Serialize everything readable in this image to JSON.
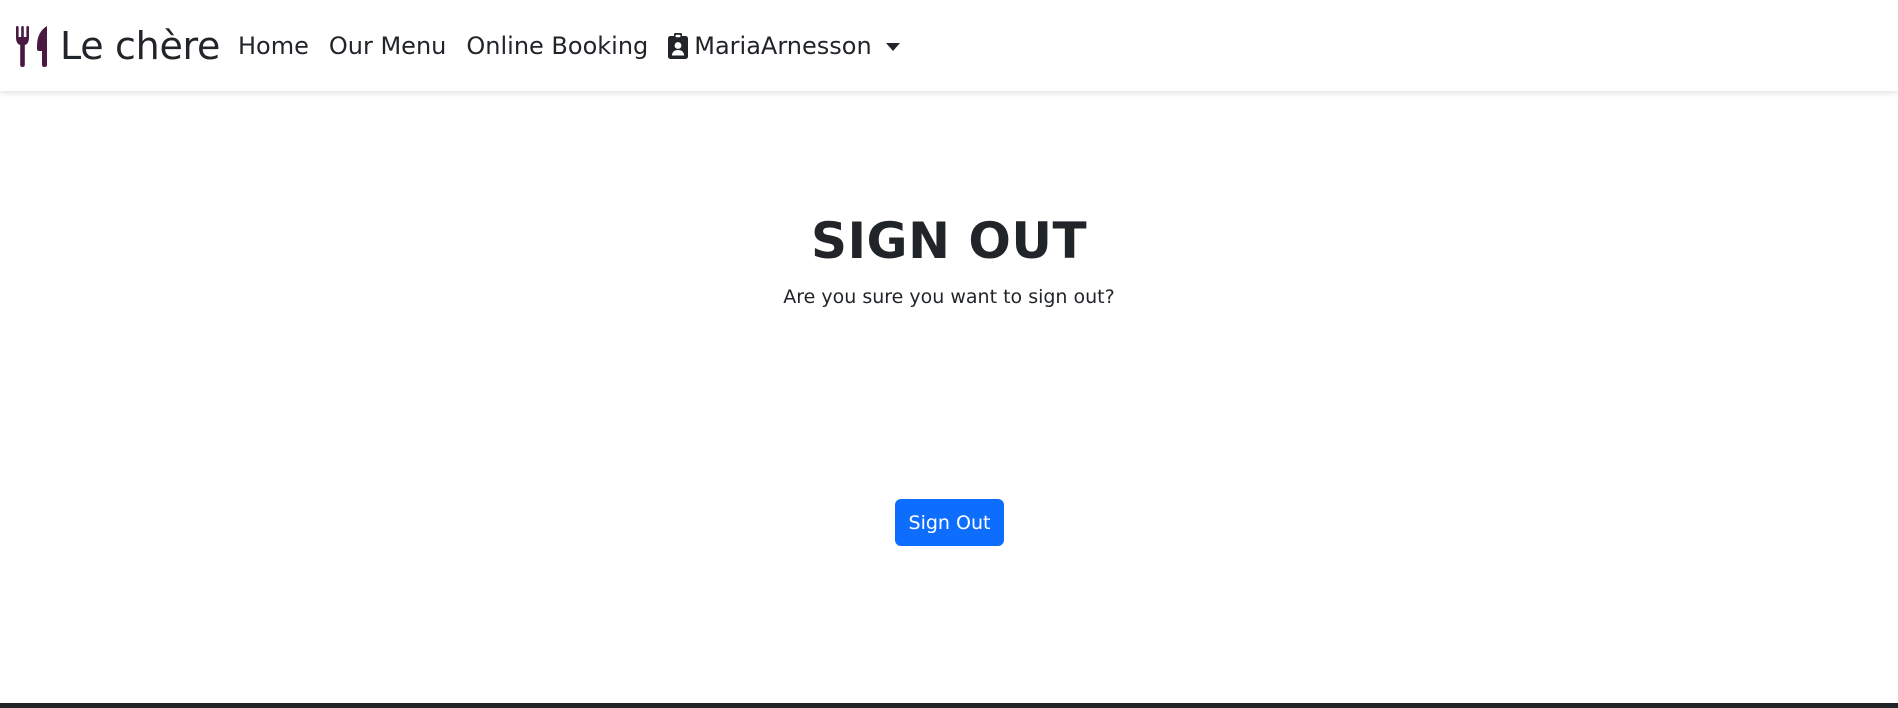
{
  "navbar": {
    "brand": {
      "icon": "utensils-icon",
      "name": "Le chère",
      "icon_color": "#4a1942"
    },
    "links": [
      {
        "label": "Home"
      },
      {
        "label": "Our Menu"
      },
      {
        "label": "Online Booking"
      }
    ],
    "user": {
      "icon": "id-badge-icon",
      "name": "MariaArnesson",
      "dropdown_icon": "caret-down-icon"
    }
  },
  "main": {
    "title": "SIGN OUT",
    "message": "Are you sure you want to sign out?",
    "sign_out_button": "Sign Out",
    "button_color": "#0d6efd"
  }
}
